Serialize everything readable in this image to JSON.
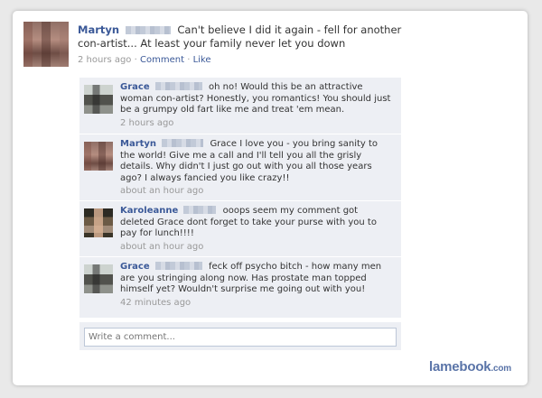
{
  "post": {
    "author": "Martyn",
    "text": "Can't believe I did it again - fell for another con-artist... At least your family never let you down",
    "time": "2 hours ago",
    "sep": "·",
    "comment_link": "Comment",
    "like_link": "Like"
  },
  "comments": [
    {
      "author": "Grace",
      "text": "oh no! Would this be an attractive woman con-artist? Honestly, you romantics! You should just be a grumpy old fart like me and treat 'em mean.",
      "time": "2 hours ago"
    },
    {
      "author": "Martyn",
      "text": "Grace I love you - you bring sanity to the world! Give me a call and I'll tell you all the grisly details. Why didn't I just go out with you all those years ago? I always fancied you like crazy!!",
      "time": "about an hour ago"
    },
    {
      "author": "Karoleanne",
      "text": "ooops seem my comment got deleted Grace dont forget to take your purse with you to pay for lunch!!!!",
      "time": "about an hour ago"
    },
    {
      "author": "Grace",
      "text": "feck off psycho bitch - how many men are you stringing along now. Has prostate man topped himself yet? Wouldn't surprise me going out with you!",
      "time": "42 minutes ago"
    }
  ],
  "write_comment": {
    "placeholder": "Write a comment..."
  },
  "brand": {
    "name": "lamebook",
    "tld": ".com"
  }
}
